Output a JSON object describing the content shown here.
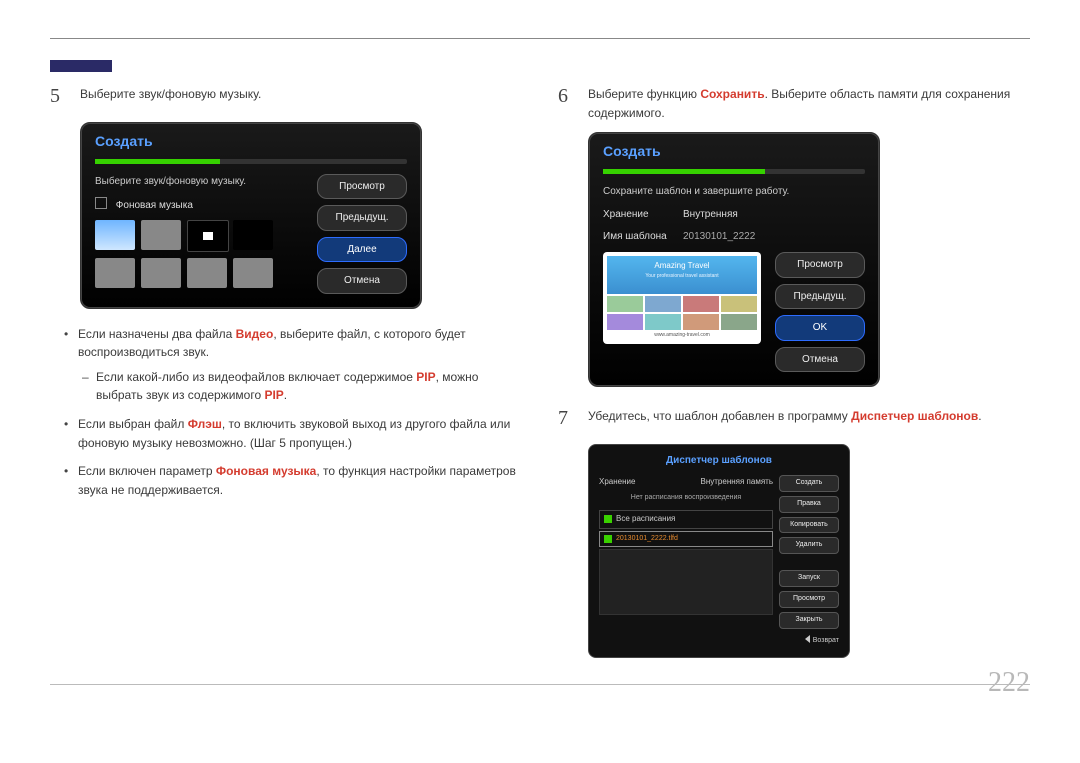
{
  "page_number": "222",
  "left": {
    "step5": {
      "num": "5",
      "text": "Выберите звук/фоновую музыку.",
      "panel": {
        "title": "Создать",
        "subtext": "Выберите звук/фоновую музыку.",
        "bgm_label": "Фоновая музыка",
        "buttons": {
          "preview": "Просмотр",
          "prev": "Предыдущ.",
          "next": "Далее",
          "cancel": "Отмена"
        }
      }
    },
    "bullets": {
      "b1_pre": "Если назначены два файла ",
      "b1_hl": "Видео",
      "b1_post": ", выберите файл, с которого будет воспроизводиться звук.",
      "b1a_pre": "Если какой-либо из видеофайлов включает содержимое ",
      "b1a_hl": "PIP",
      "b1a_mid": ", можно выбрать звук из содержимого ",
      "b1a_hl2": "PIP",
      "b1a_post": ".",
      "b2_pre": "Если выбран файл ",
      "b2_hl": "Флэш",
      "b2_post": ", то включить звуковой выход из другого файла или фоновую музыку невозможно. (Шаг 5 пропущен.)",
      "b3_pre": "Если включен параметр ",
      "b3_hl": "Фоновая музыка",
      "b3_post": ", то функция настройки параметров звука не поддерживается."
    }
  },
  "right": {
    "step6": {
      "num": "6",
      "text_pre": "Выберите функцию ",
      "text_hl": "Сохранить",
      "text_post": ". Выберите область памяти для сохранения содержимого.",
      "panel": {
        "title": "Создать",
        "subtext": "Сохраните шаблон и завершите работу.",
        "storage_label": "Хранение",
        "storage_value": "Внутренняя",
        "name_label": "Имя шаблона",
        "name_value": "20130101_2222",
        "buttons": {
          "preview": "Просмотр",
          "prev": "Предыдущ.",
          "ok": "OK",
          "cancel": "Отмена"
        },
        "preview_card": {
          "brand": "Amazing Travel",
          "tagline": "Your professional travel assistant",
          "url": "www.amazing-travel.com"
        }
      }
    },
    "step7": {
      "num": "7",
      "text_pre": "Убедитесь, что шаблон добавлен в программу ",
      "text_hl": "Диспетчер шаблонов",
      "text_post": ".",
      "tm": {
        "title": "Диспетчер шаблонов",
        "storage_label": "Хранение",
        "storage_value": "Внутренняя память",
        "no_schedule": "Нет расписания воспроизведения",
        "all_sched": "Все расписания",
        "file": "20130101_2222.tlfd",
        "buttons": {
          "create": "Создать",
          "edit": "Правка",
          "copy": "Копировать",
          "del": "Удалить",
          "run": "Запуск",
          "preview": "Просмотр",
          "close": "Закрыть"
        },
        "return": "Возврат"
      }
    }
  }
}
